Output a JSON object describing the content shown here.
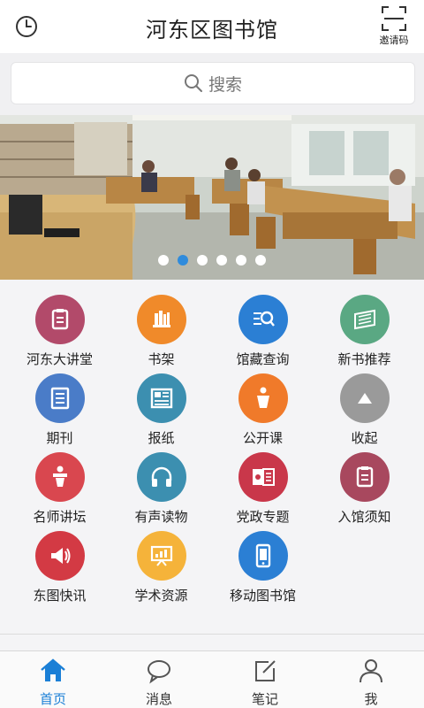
{
  "header": {
    "title": "河东区图书馆",
    "qr_label": "邀请码"
  },
  "search": {
    "placeholder": "搜索"
  },
  "banner": {
    "slides": 6,
    "active_slide": 2
  },
  "menu": {
    "items": [
      {
        "label": "河东大讲堂",
        "icon": "clipboard-icon",
        "color": "#b24a6a"
      },
      {
        "label": "书架",
        "icon": "bookshelf-icon",
        "color": "#f08a2a"
      },
      {
        "label": "馆藏查询",
        "icon": "search-list-icon",
        "color": "#2b7fd4"
      },
      {
        "label": "新书推荐",
        "icon": "new-book-icon",
        "color": "#5aa883"
      },
      {
        "label": "期刊",
        "icon": "journal-icon",
        "color": "#4a7cc8"
      },
      {
        "label": "报纸",
        "icon": "newspaper-icon",
        "color": "#3c8fb0"
      },
      {
        "label": "公开课",
        "icon": "lectern-icon",
        "color": "#f07a2a"
      },
      {
        "label": "收起",
        "icon": "collapse-icon",
        "color": "#9a9a9a"
      },
      {
        "label": "名师讲坛",
        "icon": "speaker-podium-icon",
        "color": "#d9474f"
      },
      {
        "label": "有声读物",
        "icon": "headphones-icon",
        "color": "#3c8fb0"
      },
      {
        "label": "党政专题",
        "icon": "party-book-icon",
        "color": "#c9374a"
      },
      {
        "label": "入馆须知",
        "icon": "notice-icon",
        "color": "#a8485e"
      },
      {
        "label": "东图快讯",
        "icon": "megaphone-icon",
        "color": "#d33a44"
      },
      {
        "label": "学术资源",
        "icon": "presentation-icon",
        "color": "#f5b33a"
      },
      {
        "label": "移动图书馆",
        "icon": "mobile-phone-icon",
        "color": "#2b7fd4"
      }
    ]
  },
  "tabbar": {
    "items": [
      {
        "label": "首页",
        "icon": "home-icon",
        "active": true
      },
      {
        "label": "消息",
        "icon": "chat-bubble-icon",
        "active": false
      },
      {
        "label": "笔记",
        "icon": "edit-note-icon",
        "active": false
      },
      {
        "label": "我",
        "icon": "user-icon",
        "active": false
      }
    ],
    "active_color": "#1a7fd6"
  }
}
